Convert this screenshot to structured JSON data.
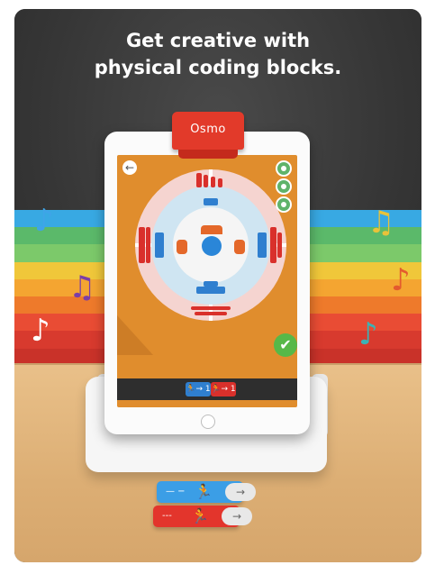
{
  "promo": {
    "headline_line1": "Get creative with",
    "headline_line2": "physical coding blocks."
  },
  "device": {
    "brand": "Osmo"
  },
  "app": {
    "back_glyph": "←",
    "check_glyph": "✔",
    "command_bar": {
      "cmd1": "Ἴ3→ 1",
      "cmd1_text": "→ 1",
      "cmd2_text": "→ 1"
    }
  },
  "decor": {
    "notes": [
      "♪",
      "♫",
      "♪",
      "♫",
      "♪",
      "♪"
    ],
    "stripe_colors": [
      "#38a9e3",
      "#5bb96a",
      "#7cc96a",
      "#f0c73a",
      "#f4a531",
      "#ee7a2b",
      "#e94c34",
      "#d83a2e",
      "#c93229"
    ],
    "note_colors": [
      "#3fa4e8",
      "#7b3ea8",
      "#ffffff",
      "#e8c23a",
      "#e45a2e",
      "#3bb3b6"
    ]
  },
  "blocks": {
    "block1_dash": "— −",
    "block1_icon": "Ἴ3",
    "block1_arrow": "→",
    "block2_dash": "‐‐‐",
    "block2_icon": "Ἴ3",
    "block2_arrow": "→"
  }
}
